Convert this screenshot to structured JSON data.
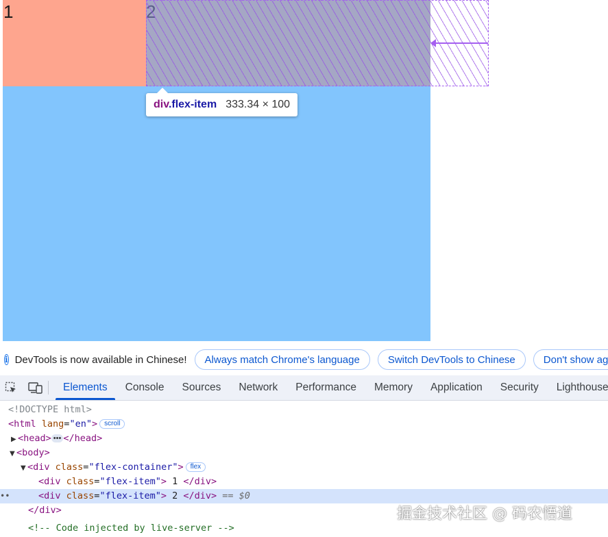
{
  "page": {
    "item1_label": "1",
    "item2_label": "2",
    "colors": {
      "item1": "#fea58e",
      "item2": "#a5a7c4",
      "container": "#82c5fd",
      "highlight": "#a55ff0"
    }
  },
  "tooltip": {
    "tag": "div",
    "class": ".flex-item",
    "dimensions": "333.34 × 100"
  },
  "infobar": {
    "icon": "info-icon",
    "message": "DevTools is now available in Chinese!",
    "buttons": [
      "Always match Chrome's language",
      "Switch DevTools to Chinese",
      "Don't show again"
    ]
  },
  "toolbar": {
    "icons": [
      "inspect-element-icon",
      "device-toolbar-icon"
    ],
    "tabs": [
      "Elements",
      "Console",
      "Sources",
      "Network",
      "Performance",
      "Memory",
      "Application",
      "Security",
      "Lighthouse"
    ],
    "active_tab": "Elements"
  },
  "dom": {
    "doctype": "<!DOCTYPE html>",
    "html_open": "<html",
    "lang_attr": "lang",
    "lang_val": "\"en\"",
    "html_close_bracket": ">",
    "scroll_badge": "scroll",
    "head_open": "<head>",
    "head_close": "</head>",
    "body_open": "<body>",
    "div_open": "<div",
    "class_attr": "class",
    "container_class": "\"flex-container\"",
    "flex_badge": "flex",
    "item_class": "\"flex-item\"",
    "item1_text": " 1 ",
    "item2_text": " 2 ",
    "div_close": "</div>",
    "selected_marker": "== $0",
    "comment": "<!-- Code injected by live-server -->"
  },
  "watermark": "掘金技术社区 @ 码农悟道"
}
